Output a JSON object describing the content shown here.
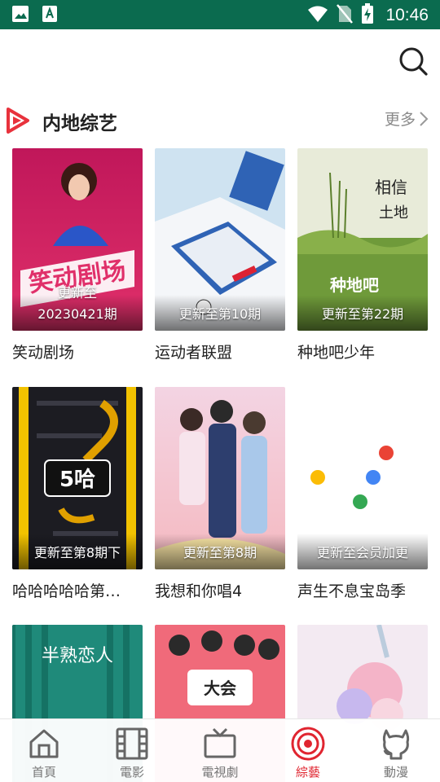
{
  "status_bar": {
    "time": "10:46",
    "icons": [
      "image-icon",
      "a-icon",
      "wifi-icon",
      "no-sim-icon",
      "battery-charging-icon"
    ]
  },
  "header": {
    "search_icon": "search-icon"
  },
  "section": {
    "title": "内地综艺",
    "more_label": "更多",
    "accent": "#e8323c"
  },
  "cards": [
    {
      "title": "笑动剧场",
      "badge": "20230421期",
      "badge_top": "更新至"
    },
    {
      "title": "运动者联盟",
      "badge": "更新至第10期"
    },
    {
      "title": "种地吧少年",
      "badge": "更新至第22期"
    },
    {
      "title": "哈哈哈哈哈第…",
      "badge": "更新至第8期下"
    },
    {
      "title": "我想和你唱4",
      "badge": "更新至第8期"
    },
    {
      "title": "声生不息宝岛季",
      "badge": "更新至会员加更"
    },
    {
      "title": "",
      "badge": ""
    },
    {
      "title": "",
      "badge": ""
    },
    {
      "title": "",
      "badge": ""
    }
  ],
  "bottom_nav": {
    "items": [
      {
        "label": "首頁",
        "icon": "home-icon"
      },
      {
        "label": "電影",
        "icon": "film-icon"
      },
      {
        "label": "電視劇",
        "icon": "tv-icon"
      },
      {
        "label": "綜藝",
        "icon": "target-icon",
        "active": true
      },
      {
        "label": "動漫",
        "icon": "github-cat-icon"
      }
    ],
    "active_color": "#e02530"
  }
}
